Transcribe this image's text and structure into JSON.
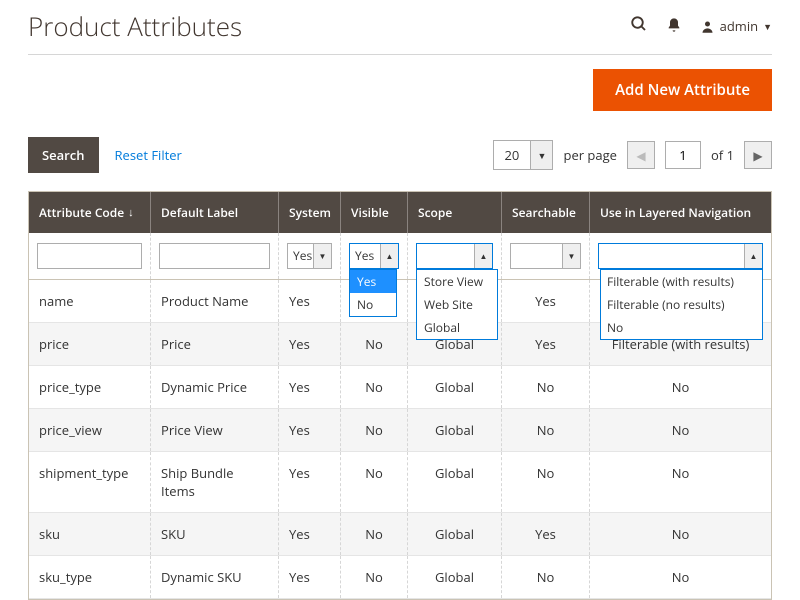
{
  "header": {
    "title": "Product Attributes",
    "admin_label": "admin"
  },
  "actions": {
    "add_new": "Add New Attribute"
  },
  "toolbar": {
    "search": "Search",
    "reset": "Reset Filter",
    "page_size": "20",
    "per_page": "per page",
    "current_page": "1",
    "of": "of",
    "total_pages": "1"
  },
  "columns": {
    "code": "Attribute Code",
    "label": "Default Label",
    "system": "System",
    "visible": "Visible",
    "scope": "Scope",
    "searchable": "Searchable",
    "layered": "Use in Layered Navigation"
  },
  "filters": {
    "system_value": "Yes",
    "visible_value": "Yes",
    "visible_options": [
      "Yes",
      "No"
    ],
    "scope_options": [
      "Store View",
      "Web Site",
      "Global"
    ],
    "layered_options": [
      "Filterable (with results)",
      "Filterable (no results)",
      "No"
    ]
  },
  "rows": [
    {
      "code": "name",
      "label": "Product Name",
      "system": "Yes",
      "visible": "No",
      "scope": "",
      "searchable": "Yes",
      "layered": ""
    },
    {
      "code": "price",
      "label": "Price",
      "system": "Yes",
      "visible": "No",
      "scope": "Global",
      "searchable": "Yes",
      "layered": "Filterable (with results)"
    },
    {
      "code": "price_type",
      "label": "Dynamic Price",
      "system": "Yes",
      "visible": "No",
      "scope": "Global",
      "searchable": "No",
      "layered": "No"
    },
    {
      "code": "price_view",
      "label": "Price View",
      "system": "Yes",
      "visible": "No",
      "scope": "Global",
      "searchable": "No",
      "layered": "No"
    },
    {
      "code": "shipment_type",
      "label": "Ship Bundle Items",
      "system": "Yes",
      "visible": "No",
      "scope": "Global",
      "searchable": "No",
      "layered": "No"
    },
    {
      "code": "sku",
      "label": "SKU",
      "system": "Yes",
      "visible": "No",
      "scope": "Global",
      "searchable": "Yes",
      "layered": "No"
    },
    {
      "code": "sku_type",
      "label": "Dynamic SKU",
      "system": "Yes",
      "visible": "No",
      "scope": "Global",
      "searchable": "No",
      "layered": "No"
    }
  ]
}
